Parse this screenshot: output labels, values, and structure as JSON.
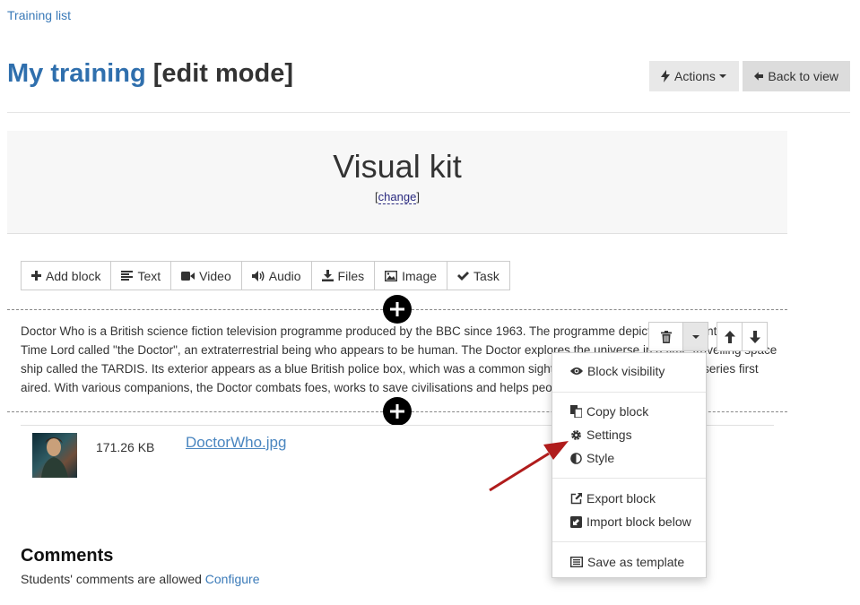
{
  "breadcrumb": "Training list",
  "title": {
    "link": "My training",
    "mode": "[edit mode]"
  },
  "header_buttons": {
    "actions": "Actions",
    "back": "Back to view"
  },
  "kit": {
    "title": "Visual kit",
    "change_open": "[",
    "change": "change",
    "change_close": "]"
  },
  "toolbar": [
    "Add block",
    "Text",
    "Video",
    "Audio",
    "Files",
    "Image",
    "Task"
  ],
  "block_text": "Doctor Who is a British science fiction television programme produced by the BBC since 1963. The programme depicts the adventures of a Time Lord called \"the Doctor\", an extraterrestrial being who appears to be human. The Doctor explores the universe in a time-travelling space ship called the TARDIS. Its exterior appears as a blue British police box, which was a common sight in Britain in 1963 when the series first aired. With various companions, the Doctor combats foes, works to save civilisations and helps people in need.",
  "file": {
    "size": "171.26 KB",
    "name": "DoctorWho.jpg"
  },
  "comments": {
    "title": "Comments",
    "text": "Students' comments are allowed",
    "configure": "Configure"
  },
  "menu": {
    "visibility": "Block visibility",
    "copy": "Copy block",
    "settings": "Settings",
    "style": "Style",
    "export": "Export block",
    "import": "Import block below",
    "template": "Save as template"
  },
  "colors": {
    "link": "#3a7ab8",
    "arrow": "#b01c1c"
  }
}
